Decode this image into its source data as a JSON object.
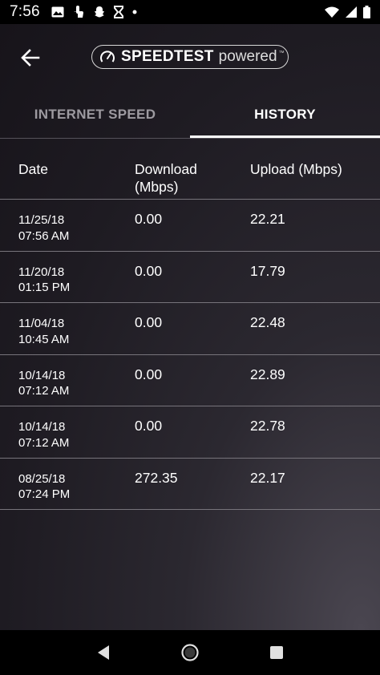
{
  "status_bar": {
    "time": "7:56",
    "left_icons": [
      "image-icon",
      "touch-icon",
      "snapchat-icon",
      "hourglass-icon",
      "dot-icon"
    ],
    "right_icons": [
      "wifi-icon",
      "signal-icon",
      "battery-icon"
    ]
  },
  "header": {
    "logo_brand": "SPEEDTEST",
    "logo_sub": "powered",
    "logo_tm": "™"
  },
  "tabs": [
    {
      "label": "INTERNET SPEED",
      "active": false
    },
    {
      "label": "HISTORY",
      "active": true
    }
  ],
  "table": {
    "columns": [
      "Date",
      "Download (Mbps)",
      "Upload (Mbps)"
    ],
    "rows": [
      {
        "date": "11/25/18",
        "time": "07:56 AM",
        "download": "0.00",
        "upload": "22.21"
      },
      {
        "date": "11/20/18",
        "time": "01:15 PM",
        "download": "0.00",
        "upload": "17.79"
      },
      {
        "date": "11/04/18",
        "time": "10:45 AM",
        "download": "0.00",
        "upload": "22.48"
      },
      {
        "date": "10/14/18",
        "time": "07:12 AM",
        "download": "0.00",
        "upload": "22.89"
      },
      {
        "date": "10/14/18",
        "time": "07:12 AM",
        "download": "0.00",
        "upload": "22.78"
      },
      {
        "date": "08/25/18",
        "time": "07:24 PM",
        "download": "272.35",
        "upload": "22.17"
      }
    ]
  },
  "nav": [
    "back-nav-icon",
    "home-nav-icon",
    "recents-nav-icon"
  ]
}
